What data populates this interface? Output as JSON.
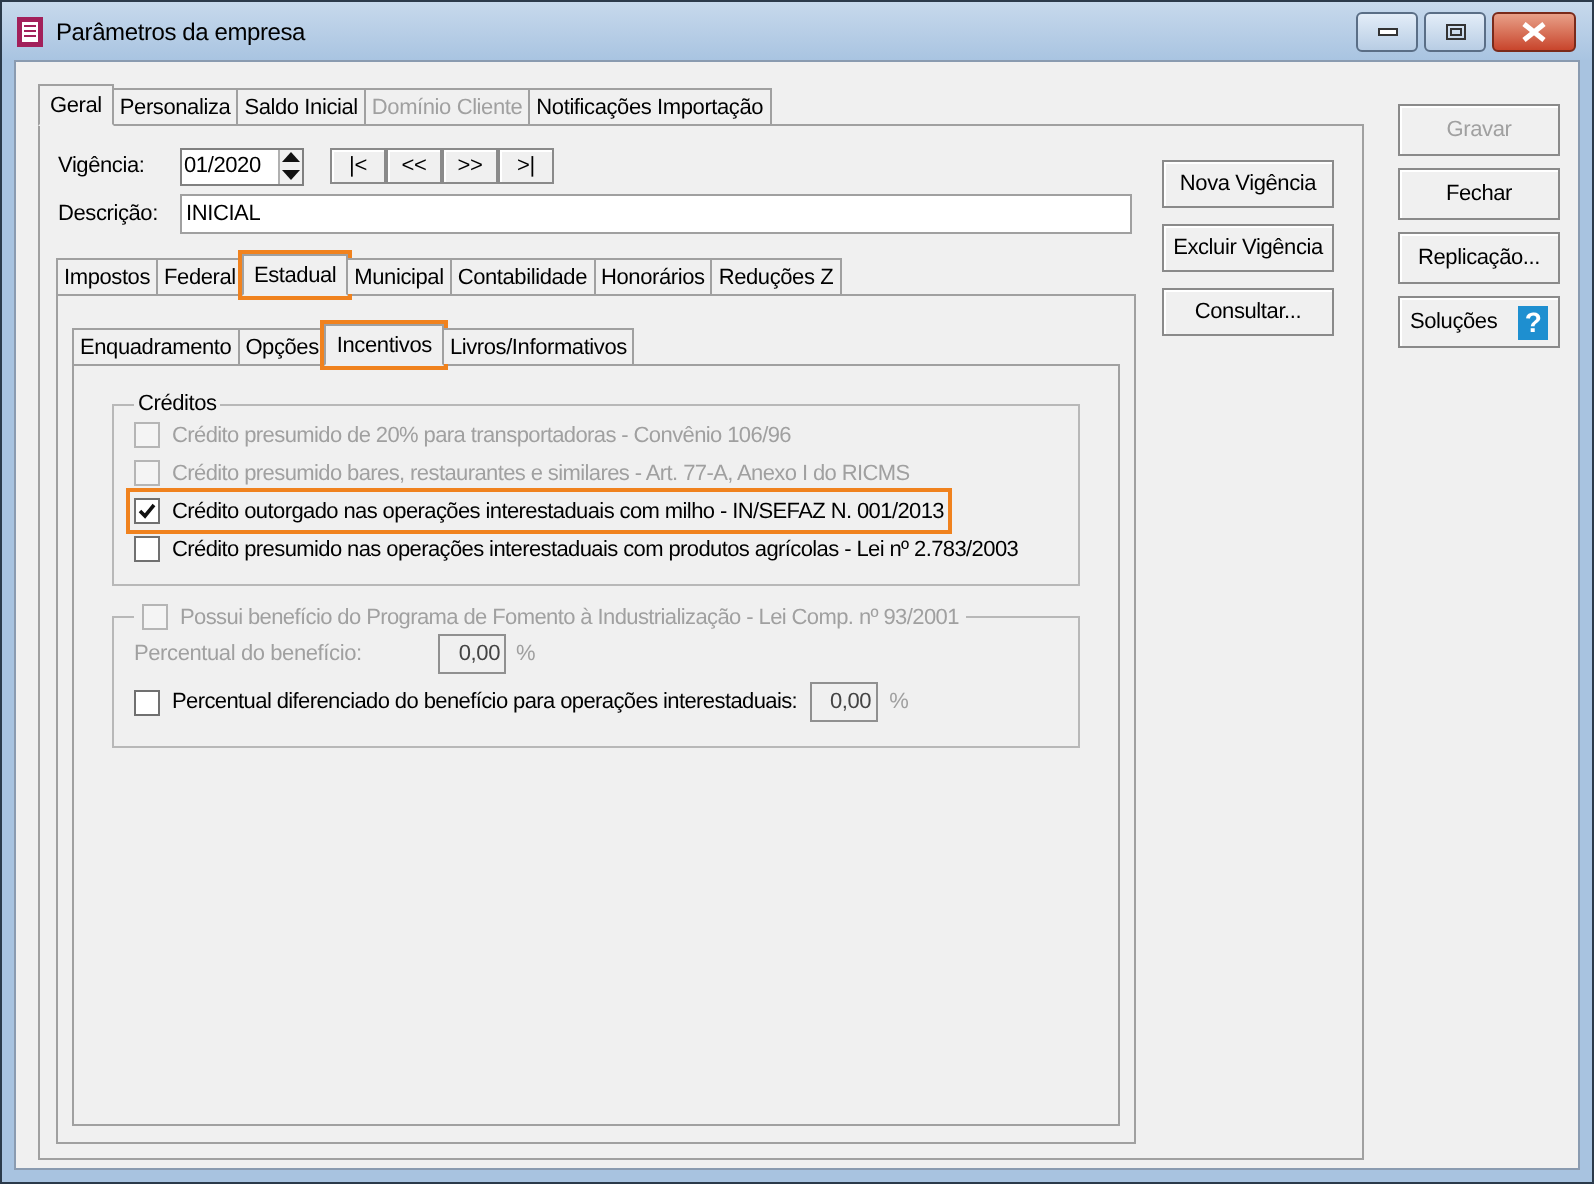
{
  "window": {
    "title": "Parâmetros da empresa"
  },
  "main_tabs": [
    {
      "label": "Geral",
      "selected": true,
      "disabled": false
    },
    {
      "label": "Personaliza",
      "selected": false,
      "disabled": false
    },
    {
      "label": "Saldo Inicial",
      "selected": false,
      "disabled": false
    },
    {
      "label": "Domínio Cliente",
      "selected": false,
      "disabled": true
    },
    {
      "label": "Notificações Importação",
      "selected": false,
      "disabled": false
    }
  ],
  "vigencia": {
    "label": "Vigência:",
    "value": "01/2020",
    "nav_buttons": [
      "|<",
      "<<",
      ">>",
      ">|"
    ]
  },
  "descricao": {
    "label": "Descrição:",
    "value": "INICIAL"
  },
  "section_tabs": [
    {
      "label": "Impostos",
      "selected": false,
      "highlighted": false
    },
    {
      "label": "Federal",
      "selected": false,
      "highlighted": false
    },
    {
      "label": "Estadual",
      "selected": true,
      "highlighted": true
    },
    {
      "label": "Municipal",
      "selected": false,
      "highlighted": false
    },
    {
      "label": "Contabilidade",
      "selected": false,
      "highlighted": false
    },
    {
      "label": "Honorários",
      "selected": false,
      "highlighted": false
    },
    {
      "label": "Reduções Z",
      "selected": false,
      "highlighted": false
    }
  ],
  "sub_tabs": [
    {
      "label": "Enquadramento",
      "selected": false,
      "highlighted": false
    },
    {
      "label": "Opções",
      "selected": false,
      "highlighted": false
    },
    {
      "label": "Incentivos",
      "selected": true,
      "highlighted": true
    },
    {
      "label": "Livros/Informativos",
      "selected": false,
      "highlighted": false
    }
  ],
  "creditos": {
    "title": "Créditos",
    "options": [
      {
        "label": "Crédito presumido de 20% para transportadoras - Convênio 106/96",
        "checked": false,
        "disabled": true,
        "highlighted": false
      },
      {
        "label": "Crédito presumido bares, restaurantes e similares - Art. 77-A, Anexo I do RICMS",
        "checked": false,
        "disabled": true,
        "highlighted": false
      },
      {
        "label": "Crédito outorgado nas operações interestaduais com milho - IN/SEFAZ N. 001/2013",
        "checked": true,
        "disabled": false,
        "highlighted": true
      },
      {
        "label": "Crédito presumido nas operações interestaduais com produtos agrícolas - Lei nº 2.783/2003",
        "checked": false,
        "disabled": false,
        "highlighted": false
      }
    ]
  },
  "fomento": {
    "label": "Possui benefício do Programa de Fomento à Industrialização - Lei Comp. nº 93/2001",
    "checked": false,
    "disabled": true,
    "percentual": {
      "label": "Percentual do benefício:",
      "value": "0,00",
      "unit": "%",
      "disabled": true
    },
    "diferenciado": {
      "label": "Percentual diferenciado do benefício para operações interestaduais:",
      "checked": false,
      "disabled": false,
      "value": "0,00",
      "unit": "%"
    }
  },
  "side_buttons": [
    "Nova Vigência",
    "Excluir Vigência",
    "Consultar..."
  ],
  "action_buttons": [
    {
      "label": "Gravar",
      "disabled": true,
      "kind": "plain"
    },
    {
      "label": "Fechar",
      "disabled": false,
      "kind": "plain"
    },
    {
      "label": "Replicação...",
      "disabled": false,
      "kind": "plain"
    },
    {
      "label": "Soluções",
      "disabled": false,
      "kind": "help",
      "icon": "?"
    }
  ]
}
